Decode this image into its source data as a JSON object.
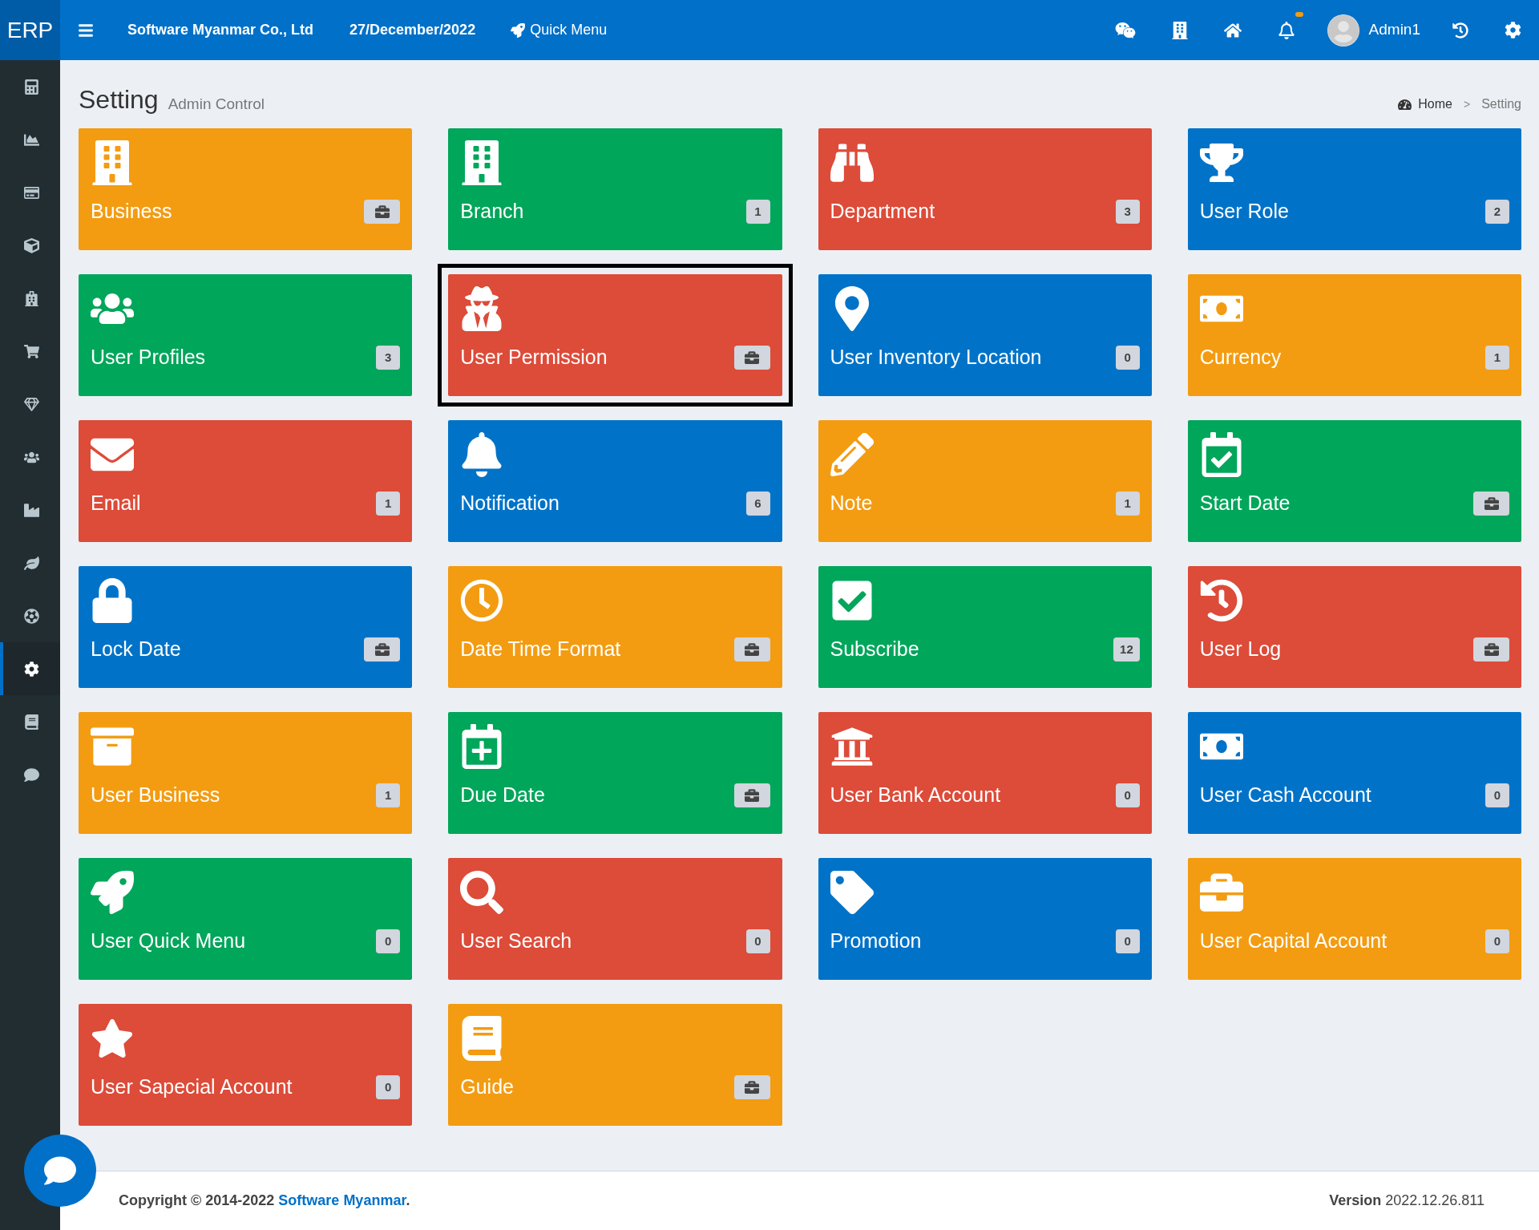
{
  "topbar": {
    "logo": "ERP",
    "company": "Software Myanmar Co., Ltd",
    "date": "27/December/2022",
    "quick_menu": "Quick Menu",
    "notification_dot": true,
    "user": "Admin1"
  },
  "sidebar": {
    "items": [
      {
        "selected": false
      },
      {
        "selected": false
      },
      {
        "selected": false
      },
      {
        "selected": false
      },
      {
        "selected": false
      },
      {
        "selected": false
      },
      {
        "selected": false
      },
      {
        "selected": false
      },
      {
        "selected": false
      },
      {
        "selected": false
      },
      {
        "selected": false
      },
      {
        "selected": true
      },
      {
        "selected": false
      },
      {
        "selected": false
      }
    ]
  },
  "header": {
    "title": "Setting",
    "subtitle": "Admin Control",
    "breadcrumb": [
      "Home",
      "Setting"
    ],
    "separator": ">"
  },
  "tiles": [
    {
      "label": "Business",
      "color": "#f39c12",
      "selected": false
    },
    {
      "label": "Branch",
      "color": "#00a65a",
      "badge": "1",
      "selected": false
    },
    {
      "label": "Department",
      "color": "#dd4b39",
      "badge": "3",
      "selected": false
    },
    {
      "label": "User Role",
      "color": "#0073c8",
      "badge": "2",
      "selected": false
    },
    {
      "label": "User Profiles",
      "color": "#00a65a",
      "badge": "3",
      "selected": false
    },
    {
      "label": "User Permission",
      "color": "#dd4b39",
      "selected": true
    },
    {
      "label": "User Inventory Location",
      "color": "#0073c8",
      "badge": "0",
      "selected": false
    },
    {
      "label": "Currency",
      "color": "#f39c12",
      "badge": "1",
      "selected": false
    },
    {
      "label": "Email",
      "color": "#dd4b39",
      "badge": "1",
      "selected": false
    },
    {
      "label": "Notification",
      "color": "#0073c8",
      "badge": "6",
      "selected": false
    },
    {
      "label": "Note",
      "color": "#f39c12",
      "badge": "1",
      "selected": false
    },
    {
      "label": "Start Date",
      "color": "#00a65a",
      "selected": false
    },
    {
      "label": "Lock Date",
      "color": "#0073c8",
      "selected": false
    },
    {
      "label": "Date Time Format",
      "color": "#f39c12",
      "selected": false
    },
    {
      "label": "Subscribe",
      "color": "#00a65a",
      "badge": "12",
      "selected": false
    },
    {
      "label": "User Log",
      "color": "#dd4b39",
      "selected": false
    },
    {
      "label": "User Business",
      "color": "#f39c12",
      "badge": "1",
      "selected": false
    },
    {
      "label": "Due Date",
      "color": "#00a65a",
      "selected": false
    },
    {
      "label": "User Bank Account",
      "color": "#dd4b39",
      "badge": "0",
      "selected": false
    },
    {
      "label": "User Cash Account",
      "color": "#0073c8",
      "badge": "0",
      "selected": false
    },
    {
      "label": "User Quick Menu",
      "color": "#00a65a",
      "badge": "0",
      "selected": false
    },
    {
      "label": "User Search",
      "color": "#dd4b39",
      "badge": "0",
      "selected": false
    },
    {
      "label": "Promotion",
      "color": "#0073c8",
      "badge": "0",
      "selected": false
    },
    {
      "label": "User Capital Account",
      "color": "#f39c12",
      "badge": "0",
      "selected": false
    },
    {
      "label": "User Sapecial Account",
      "color": "#dd4b39",
      "badge": "0",
      "selected": false
    },
    {
      "label": "Guide",
      "color": "#f39c12",
      "selected": false
    }
  ],
  "footer": {
    "copyright": "**Copyright © 2014-2022**",
    "link": "Software Myanmar",
    "end": ".",
    "version": "**Version** 2022.12.26.811"
  }
}
